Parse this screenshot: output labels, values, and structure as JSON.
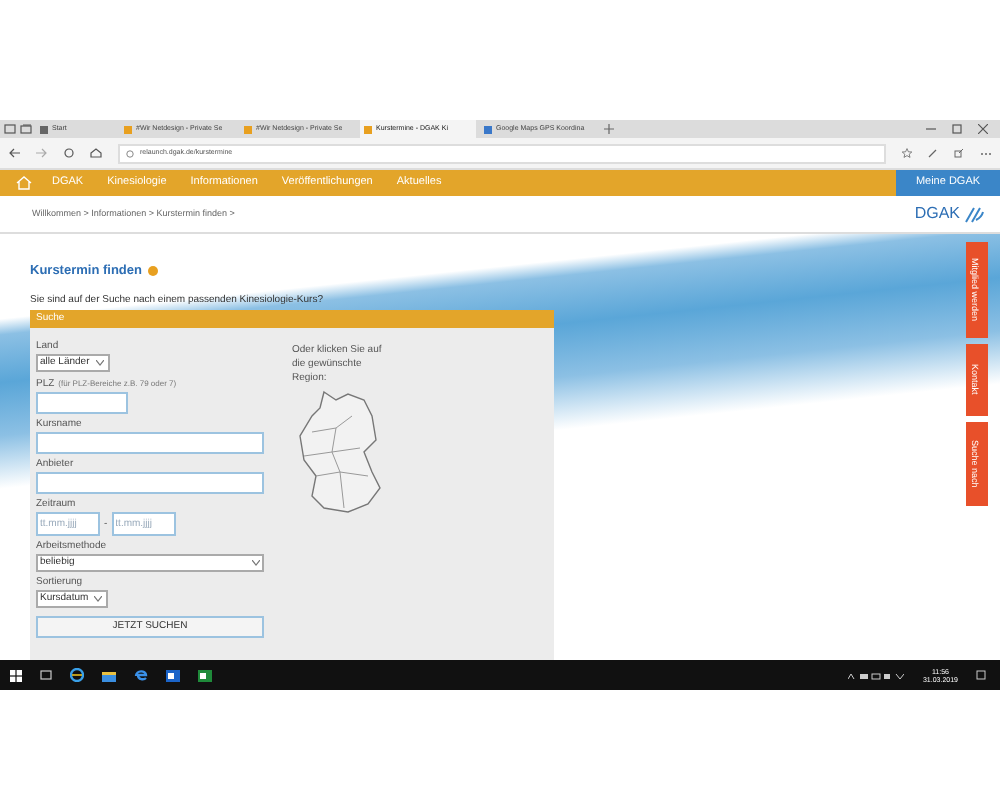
{
  "browser": {
    "tabs": [
      {
        "label": "Start",
        "selected": false
      },
      {
        "label": "#Wir Netdesign - Private Se",
        "selected": false
      },
      {
        "label": "#Wir Netdesign - Private Se",
        "selected": false
      },
      {
        "label": "Kurstermine - DGAK Ki",
        "selected": true
      },
      {
        "label": "Google Maps GPS Koordina",
        "selected": false
      }
    ],
    "address": "relaunch.dgak.de/kurstermine"
  },
  "nav": {
    "items": [
      "DGAK",
      "Kinesiologie",
      "Informationen",
      "Veröffentlichungen",
      "Aktuelles"
    ],
    "account_button": "Meine DGAK"
  },
  "breadcrumb": "Willkommen > Informationen > Kurstermin finden >",
  "logo": "DGAK",
  "heading": "Kurstermin finden",
  "intro": "Sie sind auf der Suche nach einem passenden Kinesiologie-Kurs?",
  "side_tabs": [
    "Mitglied werden",
    "Kontakt",
    "Suche nach"
  ],
  "search_panel": {
    "title": "Suche",
    "fields": [
      {
        "kind": "select",
        "label": "Land",
        "value": "alle Länder",
        "wide": false
      },
      {
        "kind": "input",
        "label": "PLZ",
        "hint": "(für PLZ-Bereiche z.B. 79 oder 7)",
        "wide": false
      },
      {
        "kind": "input",
        "label": "Kursname",
        "wide": true
      },
      {
        "kind": "input",
        "label": "Anbieter",
        "wide": true
      },
      {
        "kind": "daterange",
        "label": "Zeitraum",
        "placeholders": [
          "tt.mm.jjjj",
          "tt.mm.jjjj"
        ],
        "separator": "-"
      },
      {
        "kind": "select",
        "label": "Arbeitsmethode",
        "value": "beliebig",
        "wide": true
      },
      {
        "kind": "select",
        "label": "Sortierung",
        "value": "Kursdatum",
        "wide": false
      }
    ],
    "submit": "JETZT SUCHEN",
    "map_prompt": "Oder klicken Sie auf die gewünschte Region:"
  },
  "taskbar": {
    "time": "11:56",
    "date": "31.03.2019"
  }
}
